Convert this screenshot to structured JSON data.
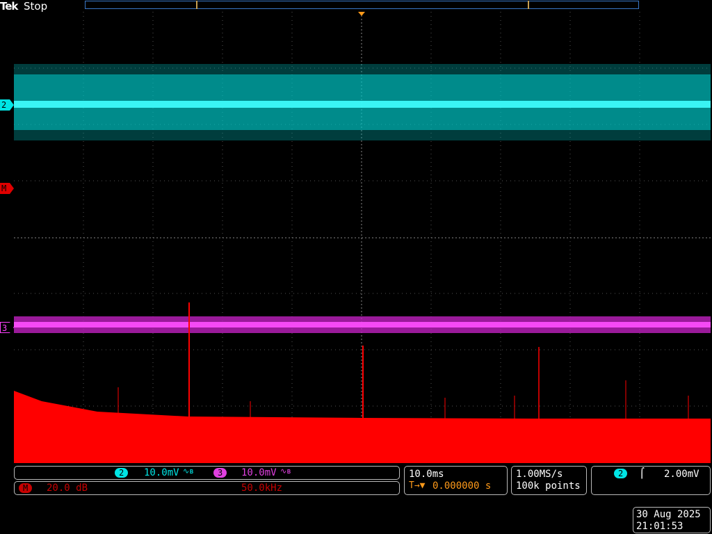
{
  "header": {
    "brand": "Tek",
    "status": "Stop"
  },
  "markers": {
    "ch2": "2",
    "math": "M",
    "ch3": "3"
  },
  "vertical": {
    "ch2_badge": "2",
    "ch2_scale": "10.0mV",
    "ch2_coupling_icon": "bandwidth-limit-icon",
    "ch3_badge": "3",
    "ch3_scale": "10.0mV",
    "ch3_coupling_icon": "bandwidth-limit-icon"
  },
  "math": {
    "badge": "M",
    "scale": "20.0 dB",
    "frequency": "50.0kHz"
  },
  "horizontal": {
    "timebase": "10.0ms",
    "trigger_icon": "trigger-position-icon",
    "delay": "0.000000 s"
  },
  "acquisition": {
    "sample_rate": "1.00MS/s",
    "record_length": "100k points"
  },
  "trigger": {
    "badge": "2",
    "slope_icon": "rising-edge-icon",
    "level": "2.00mV"
  },
  "datetime": {
    "date": "30 Aug 2025",
    "time": "21:01:53"
  },
  "colors": {
    "ch2": "#00e5e5",
    "ch3": "#e040e0",
    "math": "#ff0000",
    "trigger_marker": "#ff9a1a"
  }
}
